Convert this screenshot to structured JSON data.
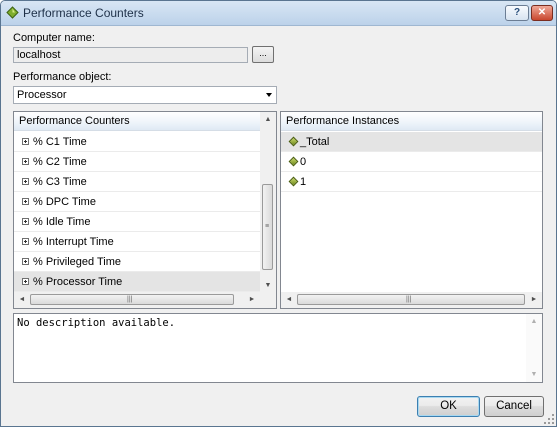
{
  "window": {
    "title": "Performance Counters",
    "help_label": "?",
    "close_label": "✕"
  },
  "computer": {
    "label": "Computer name:",
    "value": "localhost",
    "browse_label": "..."
  },
  "object": {
    "label": "Performance object:",
    "selected": "Processor"
  },
  "counters": {
    "header": "Performance Counters",
    "items": [
      {
        "label": "% C1 Time",
        "selected": false
      },
      {
        "label": "% C2 Time",
        "selected": false
      },
      {
        "label": "% C3 Time",
        "selected": false
      },
      {
        "label": "% DPC Time",
        "selected": false
      },
      {
        "label": "% Idle Time",
        "selected": false
      },
      {
        "label": "% Interrupt Time",
        "selected": false
      },
      {
        "label": "% Privileged Time",
        "selected": false
      },
      {
        "label": "% Processor Time",
        "selected": true
      }
    ]
  },
  "instances": {
    "header": "Performance Instances",
    "items": [
      {
        "label": "_Total",
        "selected": true
      },
      {
        "label": "0",
        "selected": false
      },
      {
        "label": "1",
        "selected": false
      }
    ]
  },
  "description": "No description available.",
  "buttons": {
    "ok": "OK",
    "cancel": "Cancel"
  },
  "colors": {
    "selection": "#e4e4e4",
    "titlebar": "#c8dbef",
    "close_button": "#c8462e"
  },
  "icons": {
    "app": "green-gem-icon",
    "expand": "plus-box-icon",
    "instance": "green-diamond-icon"
  }
}
